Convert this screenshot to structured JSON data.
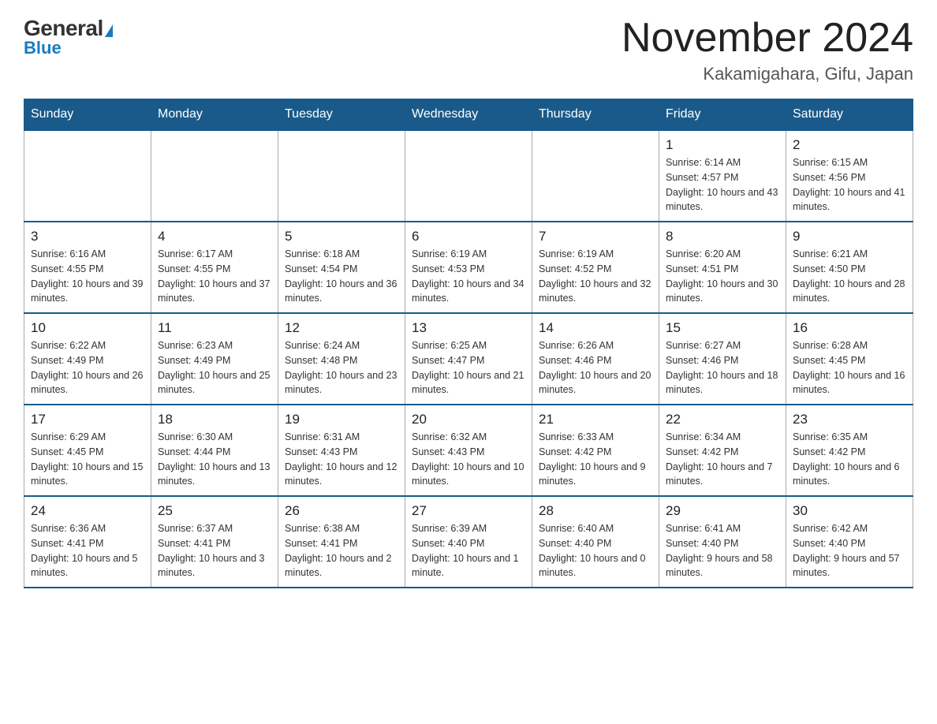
{
  "header": {
    "logo_general": "General",
    "logo_blue": "Blue",
    "month_title": "November 2024",
    "location": "Kakamigahara, Gifu, Japan"
  },
  "weekdays": [
    "Sunday",
    "Monday",
    "Tuesday",
    "Wednesday",
    "Thursday",
    "Friday",
    "Saturday"
  ],
  "weeks": [
    [
      {
        "day": "",
        "info": ""
      },
      {
        "day": "",
        "info": ""
      },
      {
        "day": "",
        "info": ""
      },
      {
        "day": "",
        "info": ""
      },
      {
        "day": "",
        "info": ""
      },
      {
        "day": "1",
        "info": "Sunrise: 6:14 AM\nSunset: 4:57 PM\nDaylight: 10 hours and 43 minutes."
      },
      {
        "day": "2",
        "info": "Sunrise: 6:15 AM\nSunset: 4:56 PM\nDaylight: 10 hours and 41 minutes."
      }
    ],
    [
      {
        "day": "3",
        "info": "Sunrise: 6:16 AM\nSunset: 4:55 PM\nDaylight: 10 hours and 39 minutes."
      },
      {
        "day": "4",
        "info": "Sunrise: 6:17 AM\nSunset: 4:55 PM\nDaylight: 10 hours and 37 minutes."
      },
      {
        "day": "5",
        "info": "Sunrise: 6:18 AM\nSunset: 4:54 PM\nDaylight: 10 hours and 36 minutes."
      },
      {
        "day": "6",
        "info": "Sunrise: 6:19 AM\nSunset: 4:53 PM\nDaylight: 10 hours and 34 minutes."
      },
      {
        "day": "7",
        "info": "Sunrise: 6:19 AM\nSunset: 4:52 PM\nDaylight: 10 hours and 32 minutes."
      },
      {
        "day": "8",
        "info": "Sunrise: 6:20 AM\nSunset: 4:51 PM\nDaylight: 10 hours and 30 minutes."
      },
      {
        "day": "9",
        "info": "Sunrise: 6:21 AM\nSunset: 4:50 PM\nDaylight: 10 hours and 28 minutes."
      }
    ],
    [
      {
        "day": "10",
        "info": "Sunrise: 6:22 AM\nSunset: 4:49 PM\nDaylight: 10 hours and 26 minutes."
      },
      {
        "day": "11",
        "info": "Sunrise: 6:23 AM\nSunset: 4:49 PM\nDaylight: 10 hours and 25 minutes."
      },
      {
        "day": "12",
        "info": "Sunrise: 6:24 AM\nSunset: 4:48 PM\nDaylight: 10 hours and 23 minutes."
      },
      {
        "day": "13",
        "info": "Sunrise: 6:25 AM\nSunset: 4:47 PM\nDaylight: 10 hours and 21 minutes."
      },
      {
        "day": "14",
        "info": "Sunrise: 6:26 AM\nSunset: 4:46 PM\nDaylight: 10 hours and 20 minutes."
      },
      {
        "day": "15",
        "info": "Sunrise: 6:27 AM\nSunset: 4:46 PM\nDaylight: 10 hours and 18 minutes."
      },
      {
        "day": "16",
        "info": "Sunrise: 6:28 AM\nSunset: 4:45 PM\nDaylight: 10 hours and 16 minutes."
      }
    ],
    [
      {
        "day": "17",
        "info": "Sunrise: 6:29 AM\nSunset: 4:45 PM\nDaylight: 10 hours and 15 minutes."
      },
      {
        "day": "18",
        "info": "Sunrise: 6:30 AM\nSunset: 4:44 PM\nDaylight: 10 hours and 13 minutes."
      },
      {
        "day": "19",
        "info": "Sunrise: 6:31 AM\nSunset: 4:43 PM\nDaylight: 10 hours and 12 minutes."
      },
      {
        "day": "20",
        "info": "Sunrise: 6:32 AM\nSunset: 4:43 PM\nDaylight: 10 hours and 10 minutes."
      },
      {
        "day": "21",
        "info": "Sunrise: 6:33 AM\nSunset: 4:42 PM\nDaylight: 10 hours and 9 minutes."
      },
      {
        "day": "22",
        "info": "Sunrise: 6:34 AM\nSunset: 4:42 PM\nDaylight: 10 hours and 7 minutes."
      },
      {
        "day": "23",
        "info": "Sunrise: 6:35 AM\nSunset: 4:42 PM\nDaylight: 10 hours and 6 minutes."
      }
    ],
    [
      {
        "day": "24",
        "info": "Sunrise: 6:36 AM\nSunset: 4:41 PM\nDaylight: 10 hours and 5 minutes."
      },
      {
        "day": "25",
        "info": "Sunrise: 6:37 AM\nSunset: 4:41 PM\nDaylight: 10 hours and 3 minutes."
      },
      {
        "day": "26",
        "info": "Sunrise: 6:38 AM\nSunset: 4:41 PM\nDaylight: 10 hours and 2 minutes."
      },
      {
        "day": "27",
        "info": "Sunrise: 6:39 AM\nSunset: 4:40 PM\nDaylight: 10 hours and 1 minute."
      },
      {
        "day": "28",
        "info": "Sunrise: 6:40 AM\nSunset: 4:40 PM\nDaylight: 10 hours and 0 minutes."
      },
      {
        "day": "29",
        "info": "Sunrise: 6:41 AM\nSunset: 4:40 PM\nDaylight: 9 hours and 58 minutes."
      },
      {
        "day": "30",
        "info": "Sunrise: 6:42 AM\nSunset: 4:40 PM\nDaylight: 9 hours and 57 minutes."
      }
    ]
  ]
}
